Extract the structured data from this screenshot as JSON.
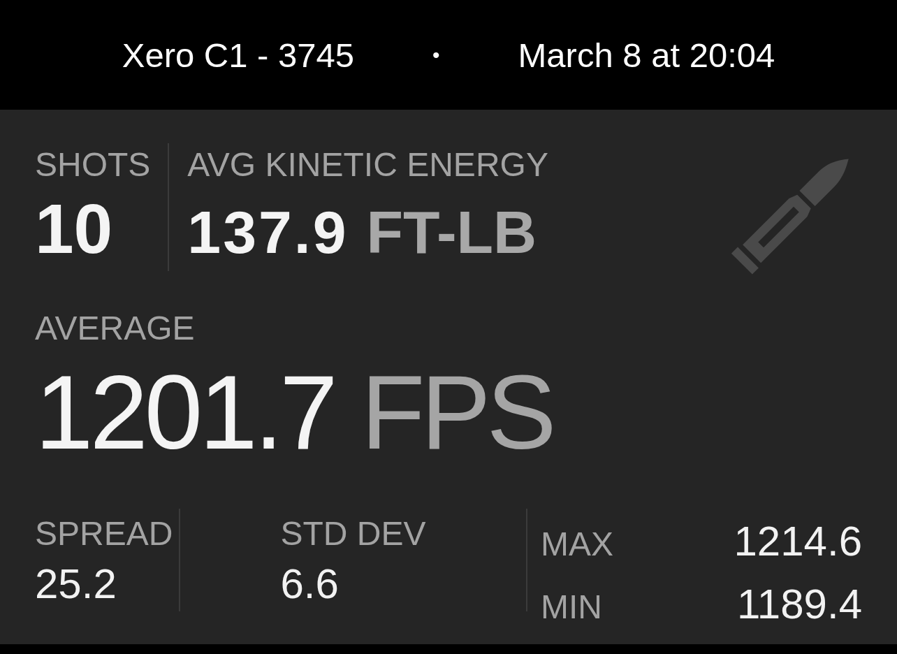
{
  "header": {
    "device": "Xero C1 - 3745",
    "separator": "•",
    "timestamp": "March 8 at 20:04"
  },
  "summary": [
    {
      "label": "SHOTS",
      "value": "10"
    },
    {
      "label": "AVG KINETIC ENERGY",
      "value": "137.9",
      "unit": "FT-LB"
    }
  ],
  "average": {
    "label": "AVERAGE",
    "value": "1201.7",
    "unit": "FPS"
  },
  "stats": [
    {
      "label": "SPREAD",
      "value": "25.2"
    },
    {
      "label": "STD DEV",
      "value": "6.6"
    }
  ],
  "extremes": [
    {
      "label": "MAX",
      "value": "1214.6"
    },
    {
      "label": "MIN",
      "value": "1189.4"
    }
  ]
}
